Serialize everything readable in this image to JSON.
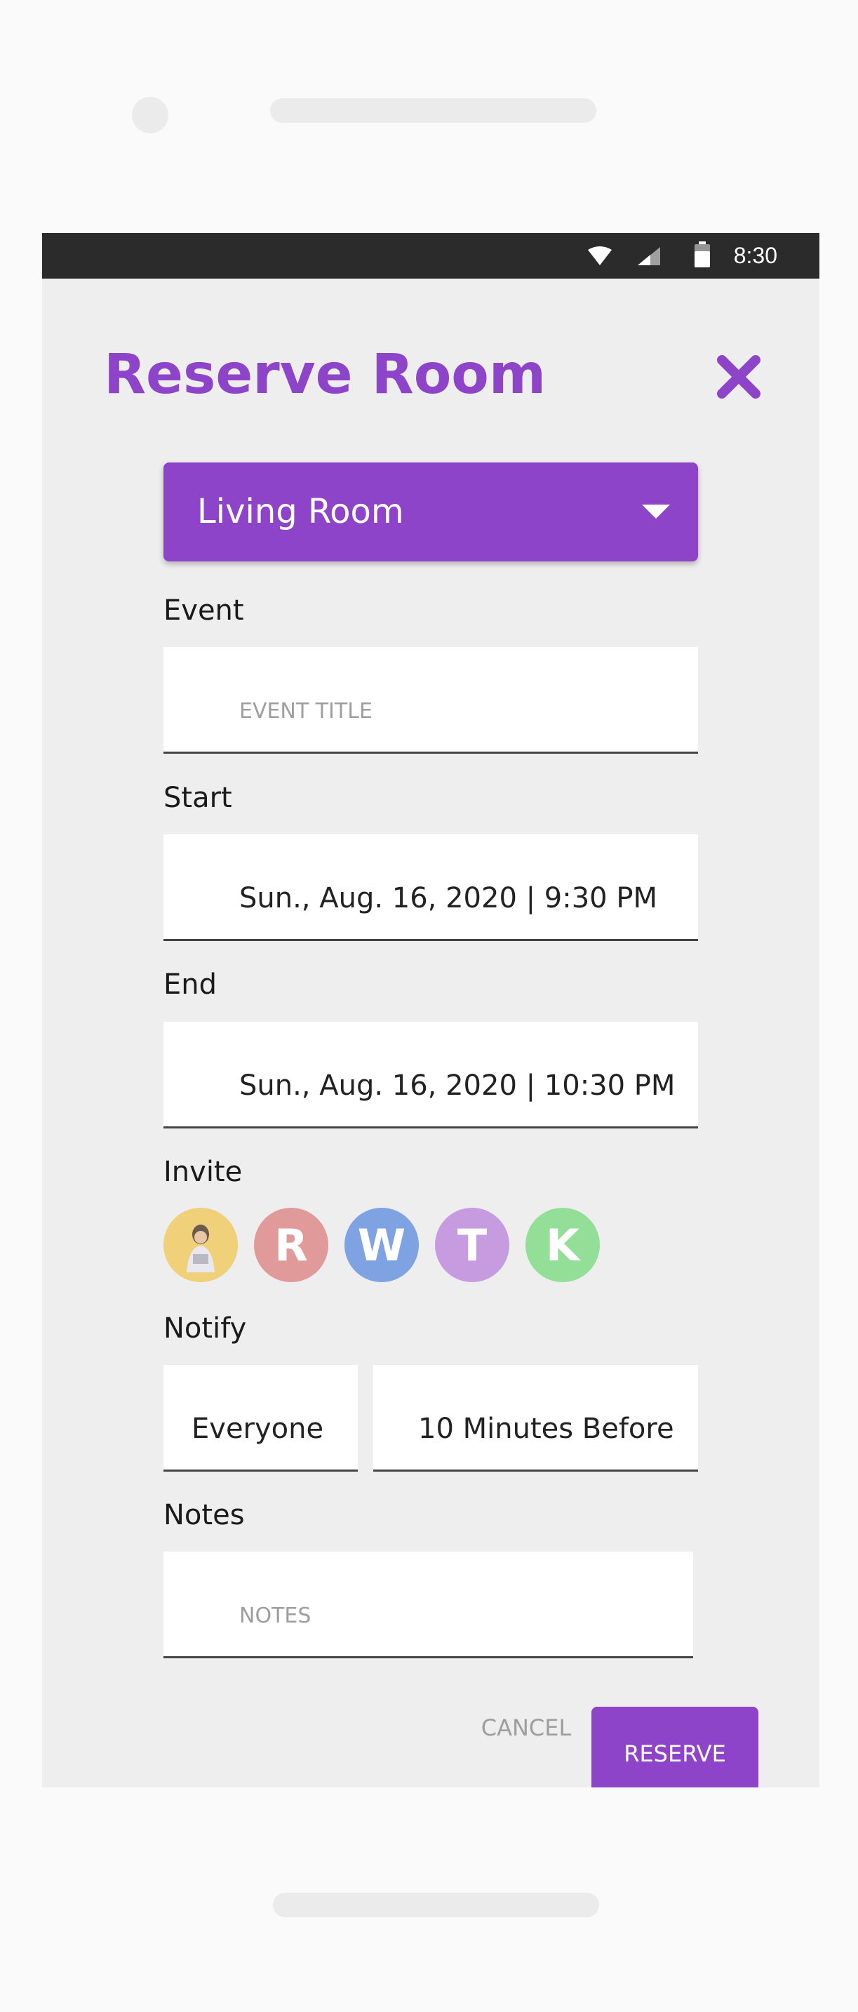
{
  "status_bar": {
    "time": "8:30"
  },
  "header": {
    "title": "Reserve Room"
  },
  "room_select": {
    "selected": "Living Room"
  },
  "event": {
    "label": "Event",
    "placeholder": "EVENT TITLE"
  },
  "start": {
    "label": "Start",
    "value": "Sun., Aug. 16, 2020 | 9:30 PM"
  },
  "end": {
    "label": "End",
    "value": "Sun., Aug. 16, 2020 | 10:30 PM"
  },
  "invite": {
    "label": "Invite",
    "avatars": [
      {
        "initial": "",
        "color": "#f1d07a"
      },
      {
        "initial": "R",
        "color": "#e09a9a"
      },
      {
        "initial": "W",
        "color": "#7fa2e3"
      },
      {
        "initial": "T",
        "color": "#c79be0"
      },
      {
        "initial": "K",
        "color": "#94df98"
      }
    ]
  },
  "notify": {
    "label": "Notify",
    "who": "Everyone",
    "when": "10 Minutes Before"
  },
  "notes": {
    "label": "Notes",
    "placeholder": "NOTES"
  },
  "actions": {
    "cancel": "CANCEL",
    "reserve": "RESERVE"
  },
  "colors": {
    "accent": "#8e44c9",
    "screen_bg": "#eeeeee",
    "status_bar": "#2b2b2b"
  }
}
